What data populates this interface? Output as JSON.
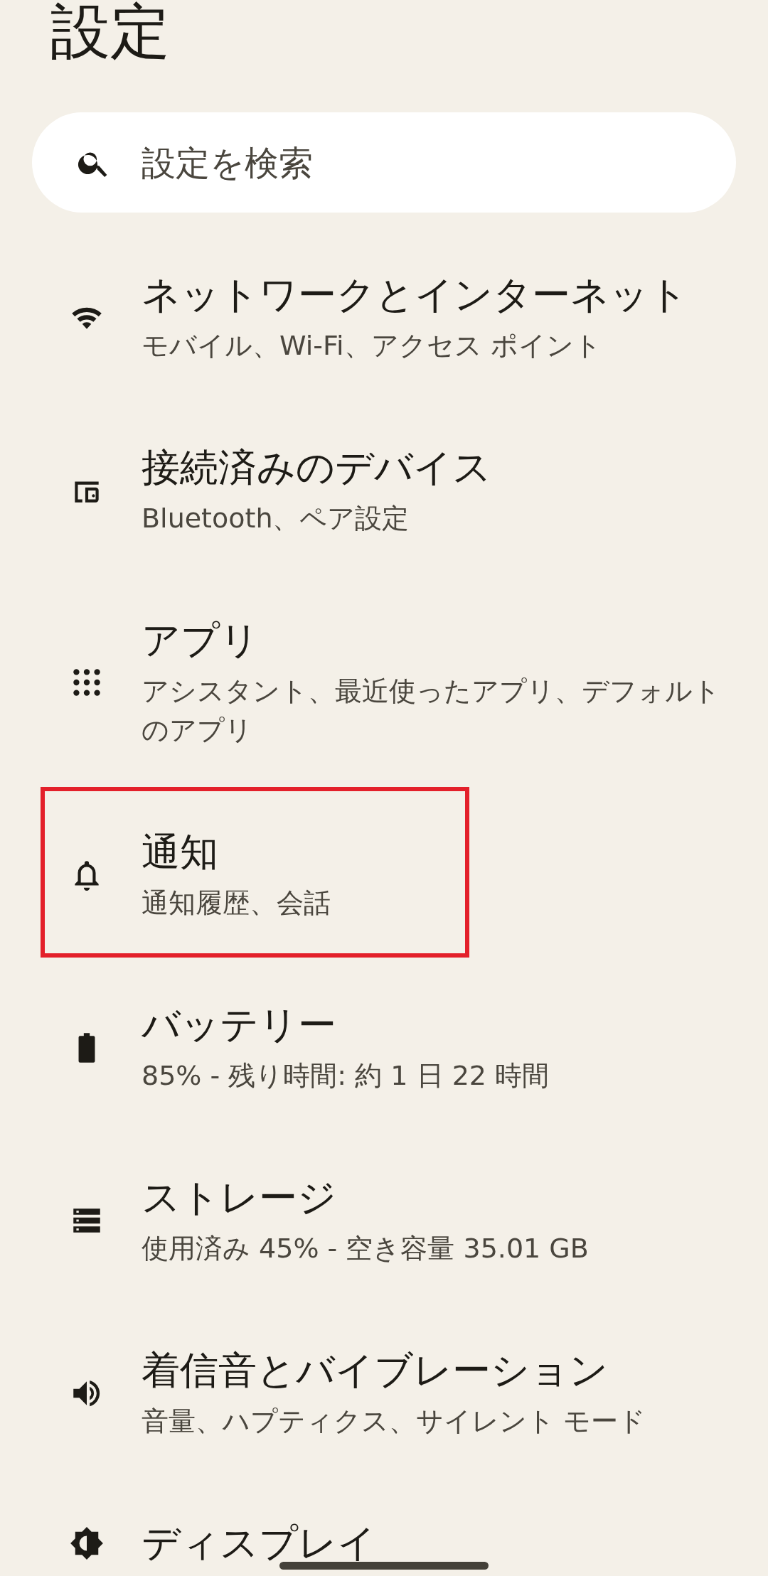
{
  "title": "設定",
  "search": {
    "placeholder": "設定を検索"
  },
  "items": [
    {
      "kind": "network",
      "title": "ネットワークとインターネット",
      "subtitle": "モバイル、Wi-Fi、アクセス ポイント",
      "highlighted": false
    },
    {
      "kind": "devices",
      "title": "接続済みのデバイス",
      "subtitle": "Bluetooth、ペア設定",
      "highlighted": false
    },
    {
      "kind": "apps",
      "title": "アプリ",
      "subtitle": "アシスタント、最近使ったアプリ、デフォルトのアプリ",
      "highlighted": false
    },
    {
      "kind": "notifications",
      "title": "通知",
      "subtitle": "通知履歴、会話",
      "highlighted": true
    },
    {
      "kind": "battery",
      "title": "バッテリー",
      "subtitle": "85% - 残り時間: 約 1 日 22 時間",
      "highlighted": false
    },
    {
      "kind": "storage",
      "title": "ストレージ",
      "subtitle": "使用済み 45% - 空き容量 35.01 GB",
      "highlighted": false
    },
    {
      "kind": "sound",
      "title": "着信音とバイブレーション",
      "subtitle": "音量、ハプティクス、サイレント モード",
      "highlighted": false
    },
    {
      "kind": "display",
      "title": "ディスプレイ",
      "highlighted": false
    }
  ]
}
